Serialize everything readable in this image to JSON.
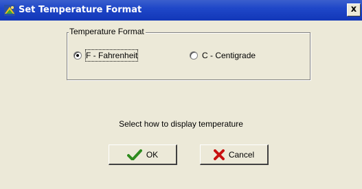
{
  "window": {
    "title": "Set Temperature Format",
    "close_glyph": "x"
  },
  "group": {
    "legend": "Temperature Format",
    "options": [
      {
        "label": "F - Fahrenheit",
        "selected": true
      },
      {
        "label": "C - Centigrade",
        "selected": false
      }
    ]
  },
  "hint": "Select how to display temperature",
  "buttons": {
    "ok_label": "OK",
    "cancel_label": "Cancel"
  },
  "icons": {
    "app": "app-icon",
    "ok": "checkmark-icon",
    "cancel": "red-x-icon"
  },
  "colors": {
    "titlebar": "#1F47C8",
    "face": "#ECE9D8",
    "ok_check": "#2E8B1E",
    "cancel_x": "#C81010"
  }
}
